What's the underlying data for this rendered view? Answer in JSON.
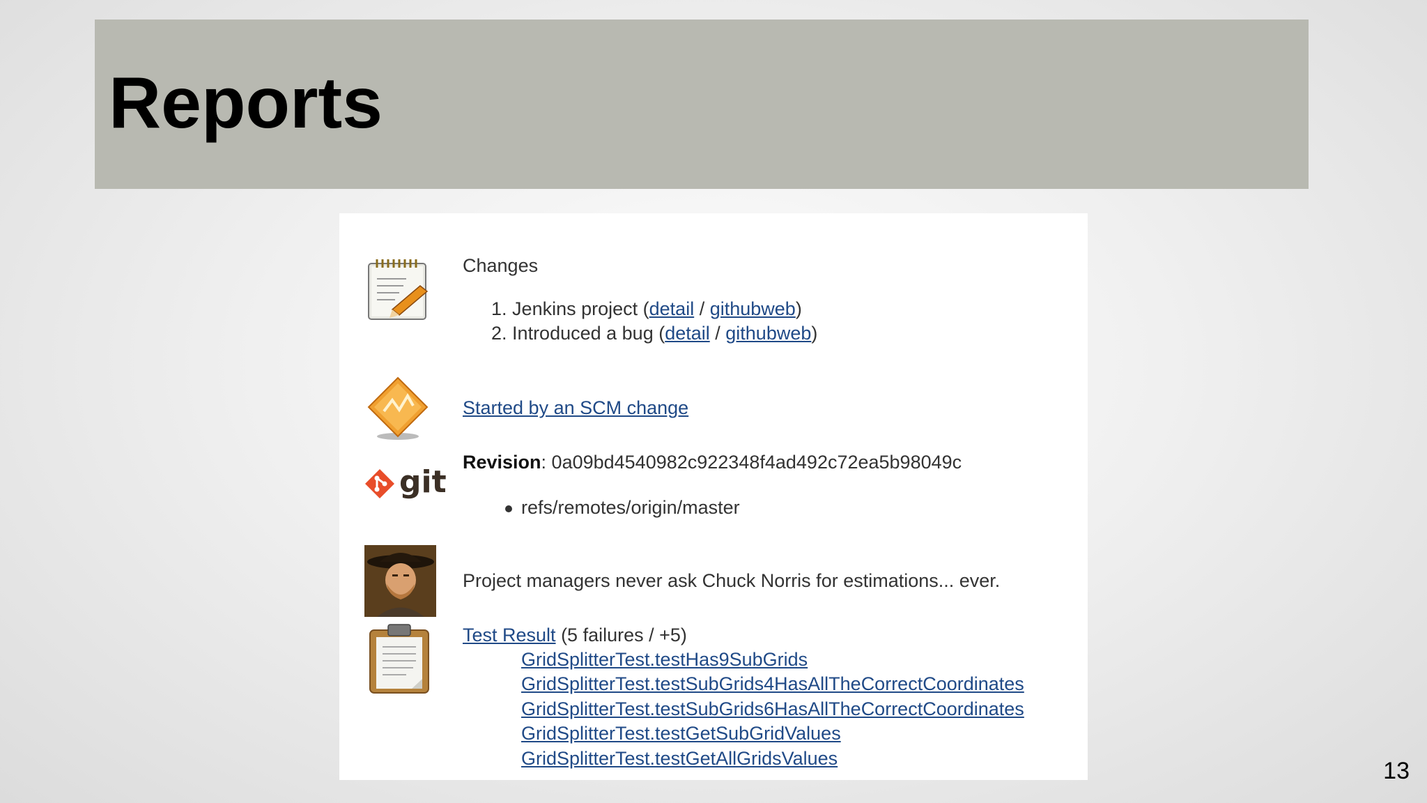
{
  "slide": {
    "title": "Reports",
    "page_number": "13"
  },
  "changes": {
    "heading": "Changes",
    "items": [
      {
        "number": "1.",
        "text": "Jenkins project (",
        "detail": "detail",
        "sep": " / ",
        "githubweb": "githubweb",
        "close": ")"
      },
      {
        "number": "2.",
        "text": "Introduced a bug (",
        "detail": "detail",
        "sep": " / ",
        "githubweb": "githubweb",
        "close": ")"
      }
    ]
  },
  "cause": {
    "link": "Started by an SCM change"
  },
  "git": {
    "icon_text": "git",
    "revision_label": "Revision",
    "revision_value": ": 0a09bd4540982c922348f4ad492c72ea5b98049c",
    "branch": "refs/remotes/origin/master"
  },
  "quote": {
    "text": "Project managers never ask Chuck Norris for estimations... ever."
  },
  "test_result": {
    "link": "Test Result",
    "summary": " (5 failures / +5)",
    "failures": [
      "GridSplitterTest.testHas9SubGrids",
      "GridSplitterTest.testSubGrids4HasAllTheCorrectCoordinates",
      "GridSplitterTest.testSubGrids6HasAllTheCorrectCoordinates",
      "GridSplitterTest.testGetSubGridValues",
      "GridSplitterTest.testGetAllGridsValues"
    ]
  },
  "icons": {
    "changes": "notepad-icon",
    "cause": "scm-diamond-icon",
    "git": "git-logo-icon",
    "avatar": "chuck-norris-avatar",
    "tests": "clipboard-icon"
  },
  "colors": {
    "title_band": "#b8b9b1",
    "link": "#204a87",
    "text": "#333333"
  }
}
